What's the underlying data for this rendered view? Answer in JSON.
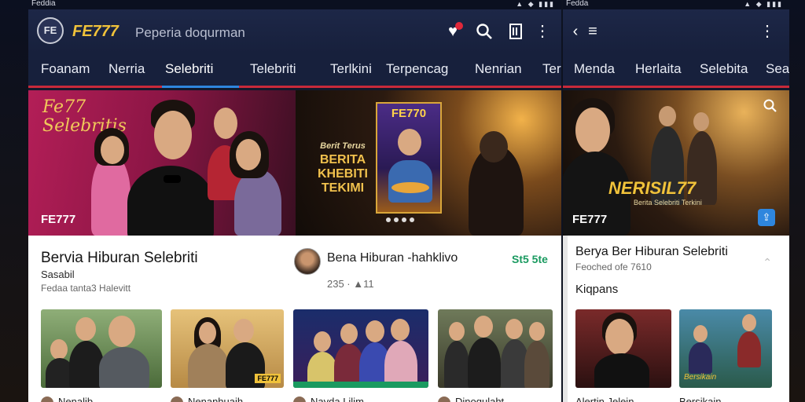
{
  "left": {
    "status": {
      "carrier": "Feddia",
      "icons": "▲ ◆ ▮▮▮"
    },
    "appbar": {
      "logo_letters": "FE",
      "logo": "FE777",
      "search_placeholder": "Peperia doqurman"
    },
    "tabs": [
      {
        "label": "Foanam"
      },
      {
        "label": "Nerria"
      },
      {
        "label": "Selebriti"
      },
      {
        "label": "Telebriti"
      },
      {
        "label": "Terlkini"
      },
      {
        "label": "Terpencag"
      },
      {
        "label": "Nenrian"
      },
      {
        "label": "Ter"
      }
    ],
    "hero": {
      "script_text": "Fe77 Selebritis",
      "promo_line1": "Berit Terus",
      "promo_line2": "BERITA",
      "promo_line3": "KHEBITI",
      "promo_line4": "TEKIMI",
      "poster_title": "FE770",
      "brand": "FE777"
    },
    "section": {
      "title": "Bervia Hiburan Selebriti",
      "subtitle": "Sasabil",
      "meta": "Fedaa tanta3 Halevitt"
    },
    "feature": {
      "title": "Bena Hiburan -hahklivo",
      "badge": "St5 5te",
      "meta": "235 · ▲11"
    },
    "cards": [
      {
        "caption": "Nenalib"
      },
      {
        "caption": "Nenanhuaih"
      },
      {
        "caption": "Nayda Lilim"
      },
      {
        "caption": "Dinoqulaht"
      }
    ],
    "card_badge": "FE777"
  },
  "right": {
    "status": {
      "carrier": "Fedda",
      "icons": "▲ ◆ ▮▮▮"
    },
    "tabs": [
      {
        "label": "Menda"
      },
      {
        "label": "Herlaita"
      },
      {
        "label": "Selebita"
      },
      {
        "label": "Seat"
      }
    ],
    "hero": {
      "title": "NERISIL77",
      "subtitle": "Berita Selebriti Terkini",
      "brand": "FE777"
    },
    "section": {
      "title": "Berya Ber Hiburan Selebriti",
      "meta": "Feoched ofe 7610",
      "label": "Kiqpans"
    },
    "cards": [
      {
        "caption": "Alertin Jelein"
      },
      {
        "caption": "Bersikain"
      }
    ]
  },
  "colors": {
    "brand_gold": "#f0c23a",
    "accent_red": "#c8293a",
    "active_tab_blue": "#2e86de",
    "appbar": "#1d2747"
  }
}
